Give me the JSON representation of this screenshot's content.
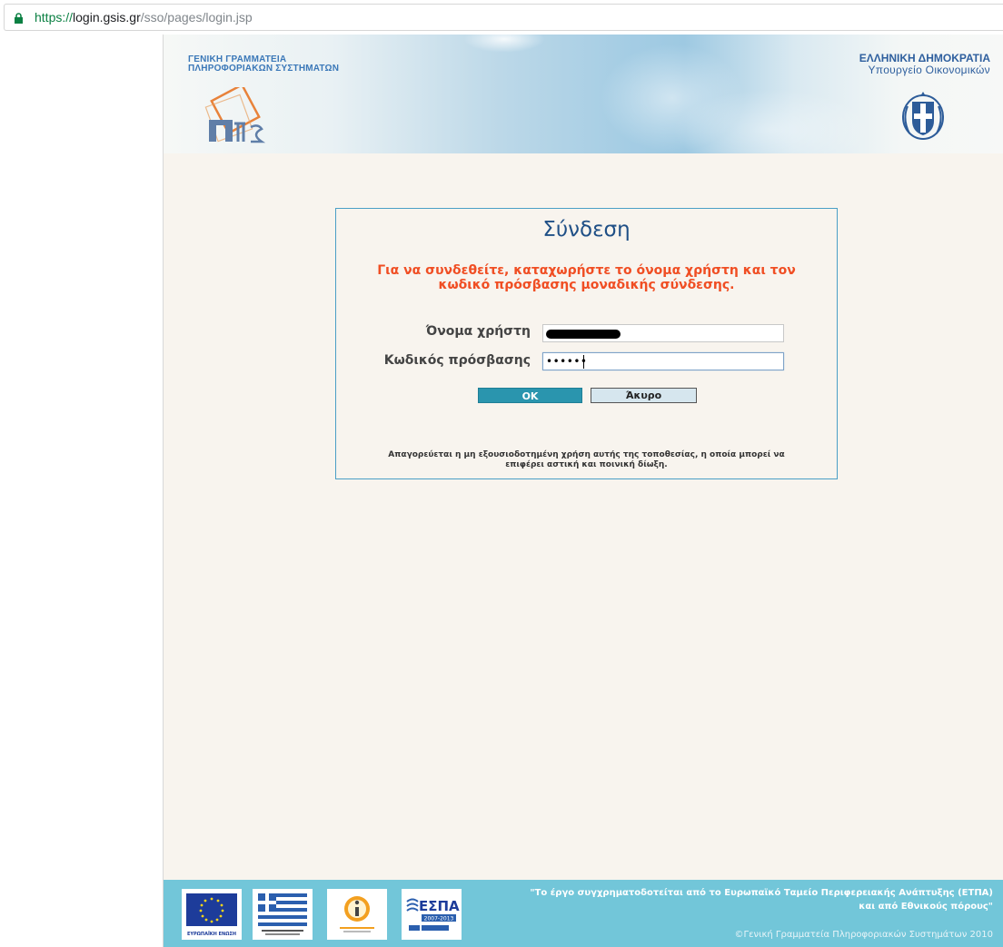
{
  "browser": {
    "url_protocol": "https://",
    "url_host": "login.gsis.gr",
    "url_path": "/sso/pages/login.jsp"
  },
  "header": {
    "org_line1": "ΓΕΝΙΚΗ ΓΡΑΜΜΑΤΕΙΑ",
    "org_line2": "ΠΛΗΡΟΦΟΡΙΑΚΩΝ ΣΥΣΤΗΜΑΤΩΝ",
    "gov_line1": "ΕΛΛΗΝΙΚΗ ΔΗΜΟΚΡΑΤΙΑ",
    "gov_line2": "Υπουργείο Οικονομικών"
  },
  "login": {
    "title": "Σύνδεση",
    "message_line1": "Για να συνδεθείτε, καταχωρήστε το όνομα χρήστη και τον",
    "message_line2": "κωδικό πρόσβασης μοναδικής σύνδεσης.",
    "username_label": "Όνομα χρήστη",
    "password_label": "Κωδικός πρόσβασης",
    "password_value": "••••••",
    "ok_label": "OK",
    "cancel_label": "Άκυρο",
    "warning_line1": "Απαγορεύεται η μη εξουσιοδοτημένη χρήση αυτής της τοποθεσίας, η οποία μπορεί να",
    "warning_line2": "επιφέρει αστική και ποινική δίωξη."
  },
  "footer": {
    "funding_line1": "\"Το έργο συγχρηματοδοτείται από το Ευρωπαϊκό Ταμείο Περιφερειακής Ανάπτυξης (ΕΤΠΑ)",
    "funding_line2": "και από Εθνικούς πόρους\"",
    "copyright": "©Γενική Γραμματεία Πληροφοριακών Συστημάτων 2010",
    "logo_eu_caption": "ΕΥΡΩΠΑΪΚΗ ΕΝΩΣΗ",
    "logo_espa_label": "ΕΣΠΑ",
    "logo_espa_years": "2007-2013"
  },
  "colors": {
    "accent": "#2a95ae",
    "title": "#1f4f86",
    "message": "#f04e23",
    "footer": "#72c6d9"
  }
}
